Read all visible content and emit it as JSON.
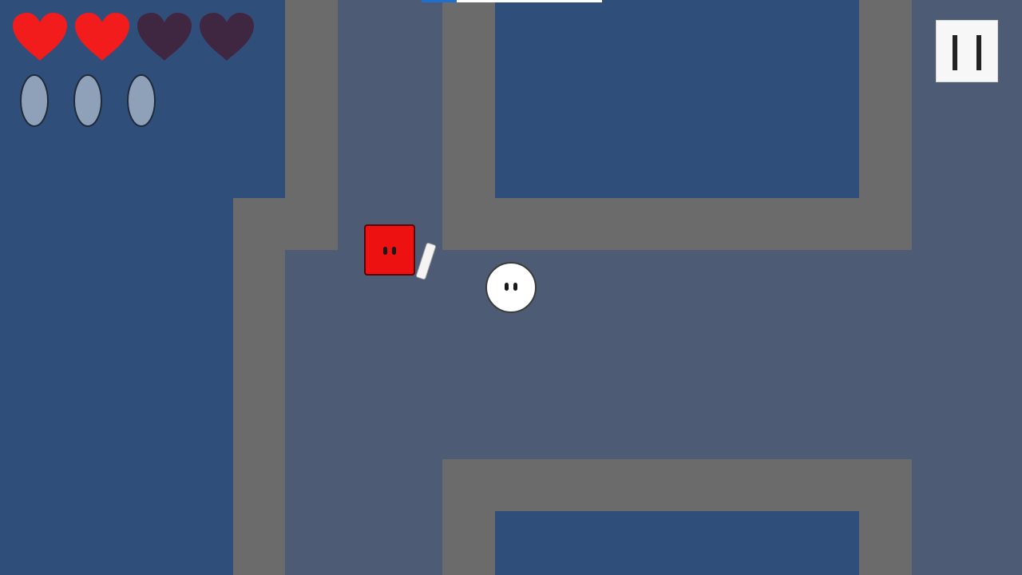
{
  "hud": {
    "lives_total": 4,
    "lives_filled": 2,
    "ammo_count": 3,
    "colors": {
      "heart_full": "#f21c1c",
      "heart_empty": "#3f2742",
      "ammo_fill": "#8ea1b8",
      "ammo_outline": "#1f2b3b"
    },
    "icons": {
      "heart": "heart-icon",
      "ammo": "ammo-oval-icon",
      "pause": "pause-icon"
    }
  },
  "colors": {
    "void": "#2f4f7a",
    "floor": "#4e5b74",
    "wall": "#6b6b6b",
    "player": "#ee1111",
    "enemy": "#ffffff"
  }
}
